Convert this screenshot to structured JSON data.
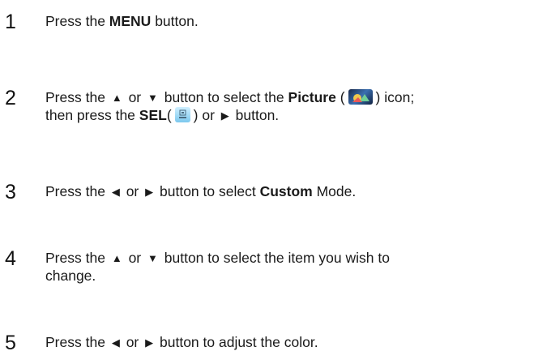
{
  "steps": [
    {
      "number": "1",
      "line1": {
        "pre": "Press the ",
        "bold": "MENU",
        "post": " button."
      }
    },
    {
      "number": "2",
      "pre": "Press the",
      "up_symbol": "▲",
      "or1": "or",
      "down_symbol": "▼",
      "mid": "button to select the",
      "bold1": "Picture",
      "open_paren": "(",
      "picture_icon": "picture-icon",
      "close_paren_icon": ") icon;",
      "line2_pre": "then press the",
      "bold2": "SEL",
      "line2_paren": "(",
      "sel_icon": "sel-button-icon",
      "line2_close": ") or",
      "right_symbol": "▶",
      "line2_post": "button."
    },
    {
      "number": "3",
      "pre": "Press the",
      "left_symbol": "◀",
      "or": "or",
      "right_symbol": "▶",
      "mid": "button to select",
      "bold": "Custom",
      "post": "Mode."
    },
    {
      "number": "4",
      "pre": "Press the",
      "up_symbol": "▲",
      "or": "or",
      "down_symbol": "▼",
      "post": "button to select the item you wish to",
      "line2": "change."
    },
    {
      "number": "5",
      "pre": "Press the",
      "left_symbol": "◀",
      "or": "or",
      "right_symbol": "▶",
      "post": "button to adjust the color."
    }
  ]
}
